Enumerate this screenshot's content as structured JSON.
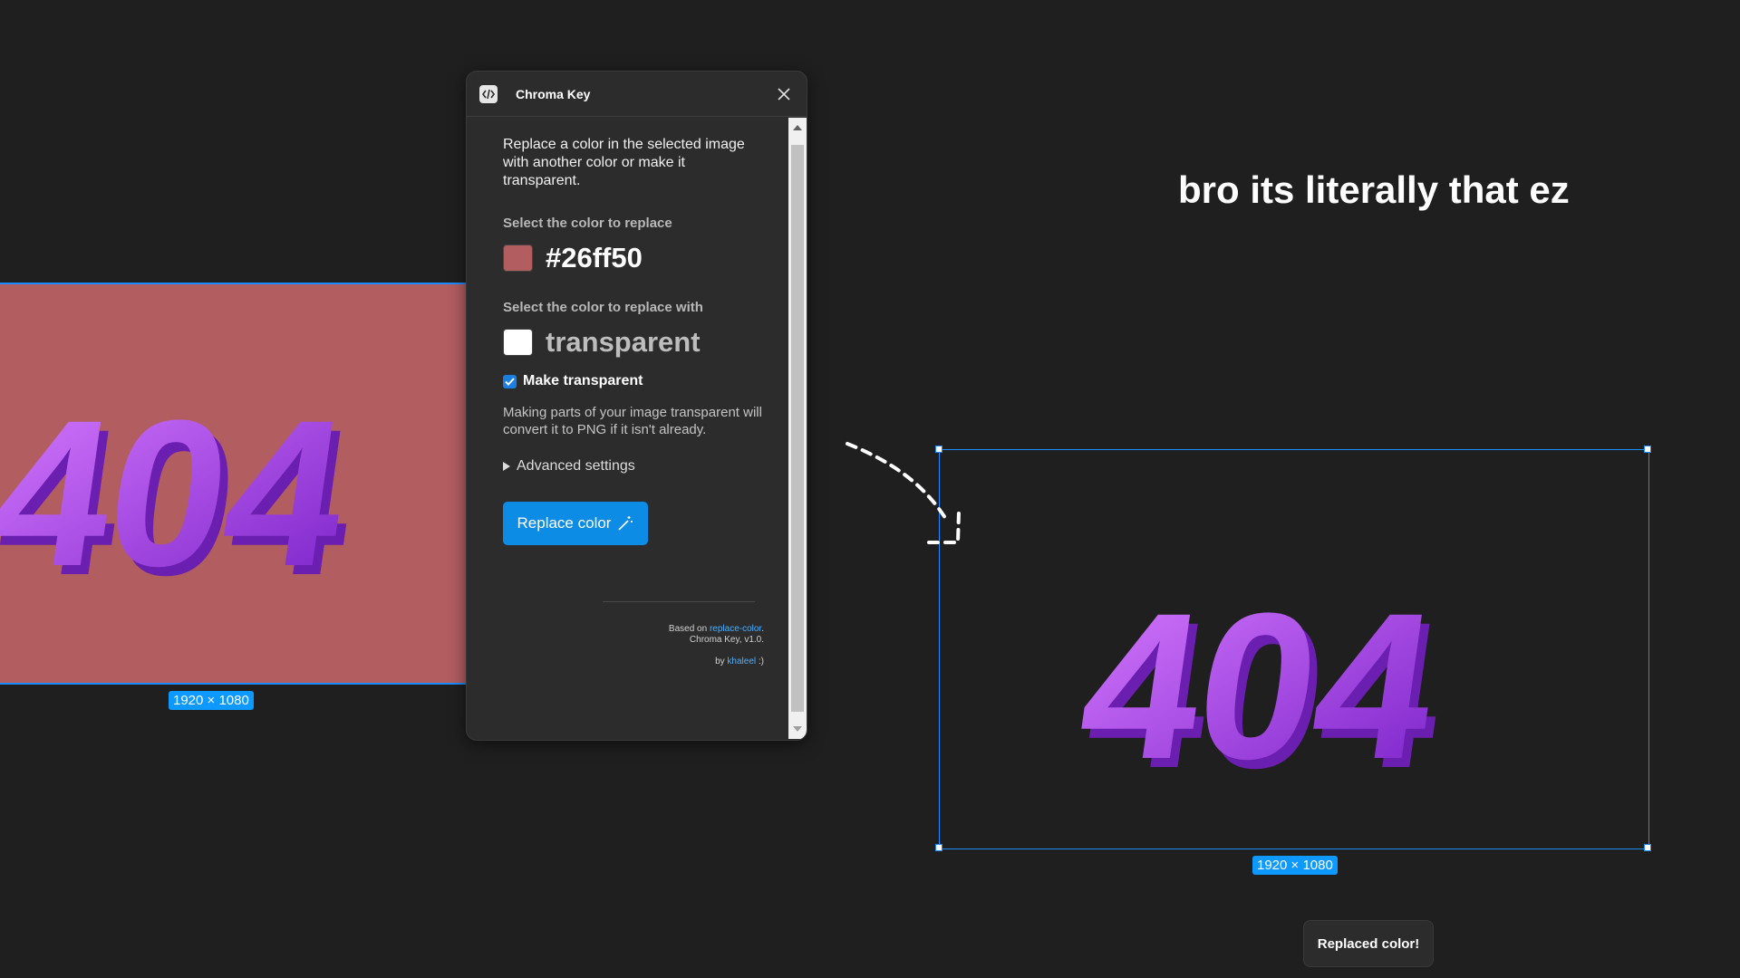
{
  "canvas": {
    "left_frame": {
      "size_label": "1920 × 1080",
      "fill_color": "#b25d5f",
      "art_text": "404"
    },
    "right_frame": {
      "size_label": "1920 × 1080",
      "art_text": "404"
    },
    "caption": "bro its literally that ez",
    "toast": "Replaced color!"
  },
  "plugin": {
    "title": "Chroma Key",
    "description": "Replace a color in the selected image with another color or make it transparent.",
    "replace_label": "Select the color to replace",
    "replace_value": "#26ff50",
    "replace_swatch": "#b25d5f",
    "with_label": "Select the color to replace with",
    "with_value": "transparent",
    "with_swatch": "#ffffff",
    "make_transparent_label": "Make transparent",
    "make_transparent_checked": true,
    "hint": "Making parts of your image transparent will convert it to PNG if it isn't already.",
    "advanced_label": "Advanced settings",
    "button_label": "Replace color",
    "credits": {
      "based_on_prefix": "Based on ",
      "based_on_link": "replace-color",
      "based_on_suffix": ".",
      "version": "Chroma Key, v1.0.",
      "by_prefix": "by ",
      "by_link": "khaleel",
      "by_suffix": " :)"
    }
  },
  "colors": {
    "accent": "#0d99ff",
    "button": "#0d8ce6",
    "art_purple": "#a63be0"
  }
}
